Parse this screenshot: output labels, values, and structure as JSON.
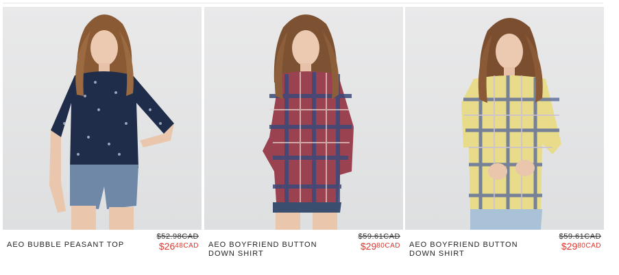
{
  "products": [
    {
      "name": "AEO BUBBLE PEASANT TOP",
      "price_original": "$52.98CAD",
      "price_sale_dollars": "$26",
      "price_sale_cents": "48CAD",
      "image_subject": "model wearing navy floral peasant top with denim shorts",
      "colors": {
        "top": "#1f2d4a",
        "bottom": "#6f88a8"
      }
    },
    {
      "name": "AEO BOYFRIEND BUTTON DOWN SHIRT",
      "price_original": "$59.61CAD",
      "price_sale_dollars": "$29",
      "price_sale_cents": "80CAD",
      "image_subject": "model wearing red and navy plaid button down shirt with denim shorts",
      "colors": {
        "top": "#9a4250",
        "accent": "#3b4a78",
        "bottom": "#3a4f70"
      }
    },
    {
      "name": "AEO BOYFRIEND BUTTON DOWN SHIRT",
      "price_original": "$59.61CAD",
      "price_sale_dollars": "$29",
      "price_sale_cents": "80CAD",
      "image_subject": "model wearing yellow and navy plaid button down shirt with light jeans",
      "colors": {
        "top": "#e8dc8a",
        "accent": "#5a6a9a",
        "bottom": "#a9c2d8"
      }
    }
  ],
  "theme": {
    "sale_color": "#e0352b",
    "text_color": "#222222"
  }
}
